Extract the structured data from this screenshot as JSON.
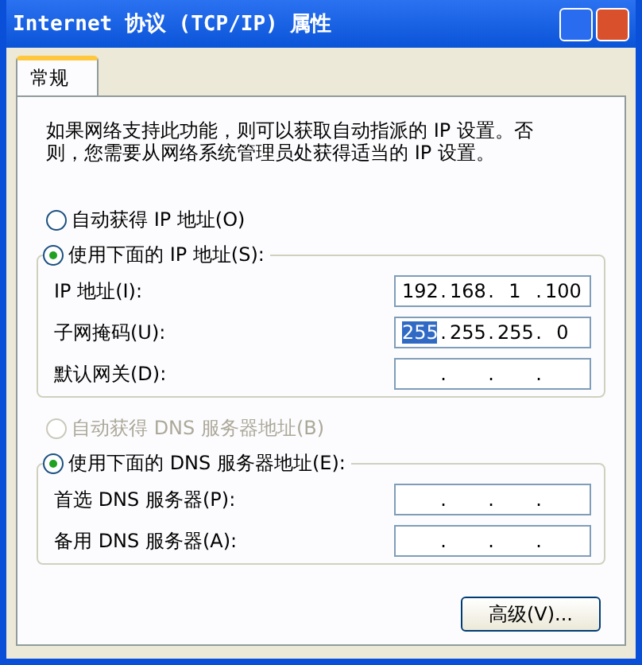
{
  "window": {
    "title": "Internet 协议 (TCP/IP) 属性"
  },
  "tabs": [
    {
      "label": "常规",
      "selected": true
    }
  ],
  "description": "如果网络支持此功能，则可以获取自动指派的 IP 设置。否则，您需要从网络系统管理员处获得适当的 IP 设置。",
  "ip_mode": [
    {
      "label": "自动获得 IP 地址(O)",
      "selected": false,
      "disabled": false
    },
    {
      "label": "使用下面的 IP 地址(S):",
      "selected": true,
      "disabled": false
    }
  ],
  "ip_fields": [
    {
      "label": "IP 地址(I):",
      "separators": [
        ".",
        ".",
        "."
      ],
      "octets": [
        {
          "text": "192",
          "selected": false
        },
        {
          "text": "168",
          "selected": false
        },
        {
          "text": "1",
          "selected": false
        },
        {
          "text": "100",
          "selected": false
        }
      ]
    },
    {
      "label": "子网掩码(U):",
      "separators": [
        ".",
        ".",
        "."
      ],
      "octets": [
        {
          "text": "255",
          "selected": true
        },
        {
          "text": "255",
          "selected": false
        },
        {
          "text": "255",
          "selected": false
        },
        {
          "text": "0",
          "selected": false
        }
      ]
    },
    {
      "label": "默认网关(D):",
      "separators": [
        ".",
        ".",
        "."
      ]
    }
  ],
  "dns_mode": [
    {
      "label": "自动获得 DNS 服务器地址(B)",
      "selected": false,
      "disabled": true
    },
    {
      "label": "使用下面的 DNS 服务器地址(E):",
      "selected": true,
      "disabled": false
    }
  ],
  "dns_fields": [
    {
      "label": "首选 DNS 服务器(P):",
      "separators": [
        ".",
        ".",
        "."
      ]
    },
    {
      "label": "备用 DNS 服务器(A):",
      "separators": [
        ".",
        ".",
        "."
      ]
    }
  ],
  "buttons": [
    {
      "label": "高级(V)..."
    }
  ]
}
